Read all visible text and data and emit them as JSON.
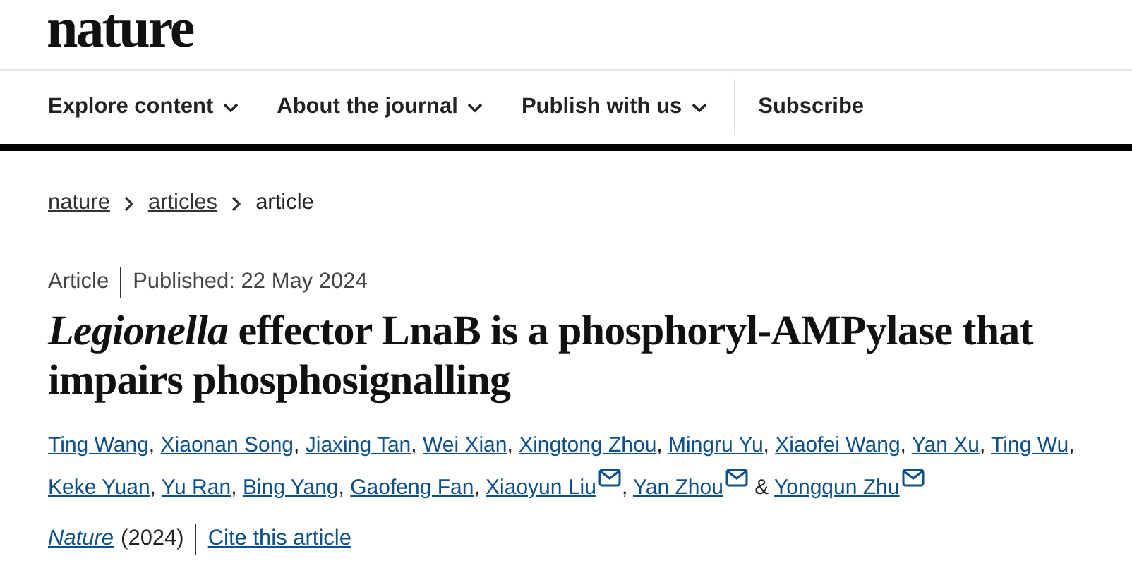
{
  "logo": "nature",
  "nav": [
    {
      "label": "Explore content",
      "dropdown": true
    },
    {
      "label": "About the journal",
      "dropdown": true
    },
    {
      "label": "Publish with us",
      "dropdown": true
    },
    {
      "label": "Subscribe",
      "dropdown": false
    }
  ],
  "breadcrumbs": [
    {
      "label": "nature",
      "link": true
    },
    {
      "label": "articles",
      "link": true
    },
    {
      "label": "article",
      "link": false
    }
  ],
  "article_type": "Article",
  "published": "Published: 22 May 2024",
  "title": "*Legionella* effector LnaB is a phosphoryl-AMPylase that impairs phosphosignalling",
  "authors": [
    {
      "name": "Ting Wang",
      "corresponding": false,
      "separator": ","
    },
    {
      "name": "Xiaonan Song",
      "corresponding": false,
      "separator": ","
    },
    {
      "name": "Jiaxing Tan",
      "corresponding": false,
      "separator": ","
    },
    {
      "name": "Wei Xian",
      "corresponding": false,
      "separator": ","
    },
    {
      "name": "Xingtong Zhou",
      "corresponding": false,
      "separator": ","
    },
    {
      "name": "Mingru Yu",
      "corresponding": false,
      "separator": ","
    },
    {
      "name": "Xiaofei Wang",
      "corresponding": false,
      "separator": ","
    },
    {
      "name": "Yan Xu",
      "corresponding": false,
      "separator": ","
    },
    {
      "name": "Ting Wu",
      "corresponding": false,
      "separator": ","
    },
    {
      "name": "Keke Yuan",
      "corresponding": false,
      "separator": ","
    },
    {
      "name": "Yu Ran",
      "corresponding": false,
      "separator": ","
    },
    {
      "name": "Bing Yang",
      "corresponding": false,
      "separator": ","
    },
    {
      "name": "Gaofeng Fan",
      "corresponding": false,
      "separator": ","
    },
    {
      "name": "Xiaoyun Liu",
      "corresponding": true,
      "separator": ","
    },
    {
      "name": "Yan Zhou",
      "corresponding": true,
      "separator": "&"
    },
    {
      "name": "Yongqun Zhu",
      "corresponding": true
    }
  ],
  "journal": "Nature",
  "year": "(2024)",
  "cite": "Cite this article"
}
